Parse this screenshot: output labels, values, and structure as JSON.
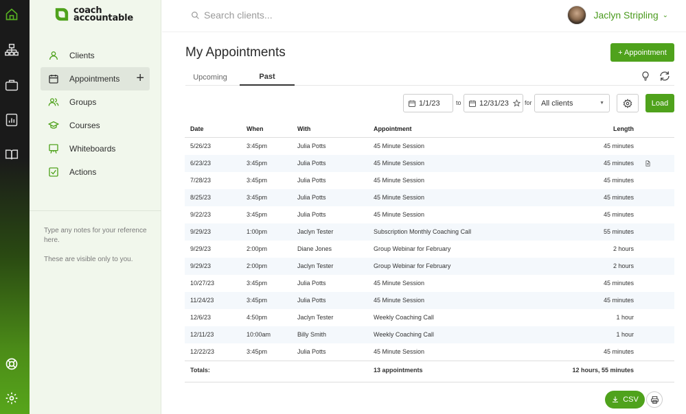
{
  "brand": {
    "line1": "coach",
    "line2": "accountable",
    "color": "#4fa21c"
  },
  "rail": {
    "icons": [
      "home-icon",
      "org-chart-icon",
      "briefcase-icon",
      "report-icon",
      "book-icon",
      "help-lifebuoy-icon",
      "settings-gear-icon"
    ]
  },
  "sidebar": {
    "items": [
      {
        "label": "Clients",
        "icon": "person-icon"
      },
      {
        "label": "Appointments",
        "icon": "calendar-icon",
        "active": true
      },
      {
        "label": "Groups",
        "icon": "group-icon"
      },
      {
        "label": "Courses",
        "icon": "graduation-cap-icon"
      },
      {
        "label": "Whiteboards",
        "icon": "whiteboard-icon"
      },
      {
        "label": "Actions",
        "icon": "checkbox-icon"
      }
    ],
    "add_symbol": "+",
    "notes": {
      "line1": "Type any notes for your reference here.",
      "line2": "These are visible only to you."
    }
  },
  "header": {
    "search_placeholder": "Search clients...",
    "user_name": "Jaclyn Stripling",
    "user_caret": "⌄"
  },
  "main": {
    "title": "My Appointments",
    "add_button": "+ Appointment",
    "tabs": [
      {
        "label": "Upcoming",
        "active": false
      },
      {
        "label": "Past",
        "active": true
      }
    ],
    "filters": {
      "from_date": "1/1/23",
      "to_label": "to",
      "to_date": "12/31/23",
      "for_label": "for",
      "client_select": "All clients",
      "load_button": "Load"
    },
    "table": {
      "headers": [
        "Date",
        "When",
        "With",
        "Appointment",
        "Length"
      ],
      "rows": [
        [
          "5/26/23",
          "3:45pm",
          "Julia Potts",
          "45 Minute Session",
          "45 minutes"
        ],
        [
          "6/23/23",
          "3:45pm",
          "Julia Potts",
          "45 Minute Session",
          "45 minutes"
        ],
        [
          "7/28/23",
          "3:45pm",
          "Julia Potts",
          "45 Minute Session",
          "45 minutes"
        ],
        [
          "8/25/23",
          "3:45pm",
          "Julia Potts",
          "45 Minute Session",
          "45 minutes"
        ],
        [
          "9/22/23",
          "3:45pm",
          "Julia Potts",
          "45 Minute Session",
          "45 minutes"
        ],
        [
          "9/29/23",
          "1:00pm",
          "Jaclyn Tester",
          "Subscription Monthly Coaching Call",
          "55 minutes"
        ],
        [
          "9/29/23",
          "2:00pm",
          "Diane Jones",
          "Group Webinar for February",
          "2 hours"
        ],
        [
          "9/29/23",
          "2:00pm",
          "Jaclyn Tester",
          "Group Webinar for February",
          "2 hours"
        ],
        [
          "10/27/23",
          "3:45pm",
          "Julia Potts",
          "45 Minute Session",
          "45 minutes"
        ],
        [
          "11/24/23",
          "3:45pm",
          "Julia Potts",
          "45 Minute Session",
          "45 minutes"
        ],
        [
          "12/6/23",
          "4:50pm",
          "Jaclyn Tester",
          "Weekly Coaching Call",
          "1 hour"
        ],
        [
          "12/11/23",
          "10:00am",
          "Billy Smith",
          "Weekly Coaching Call",
          "1 hour"
        ],
        [
          "12/22/23",
          "3:45pm",
          "Julia Potts",
          "45 Minute Session",
          "45 minutes"
        ]
      ],
      "note_row_index": 1,
      "totals": {
        "label": "Totals:",
        "appointments": "13 appointments",
        "length": "12 hours, 55 minutes"
      }
    },
    "csv_button": "CSV"
  }
}
